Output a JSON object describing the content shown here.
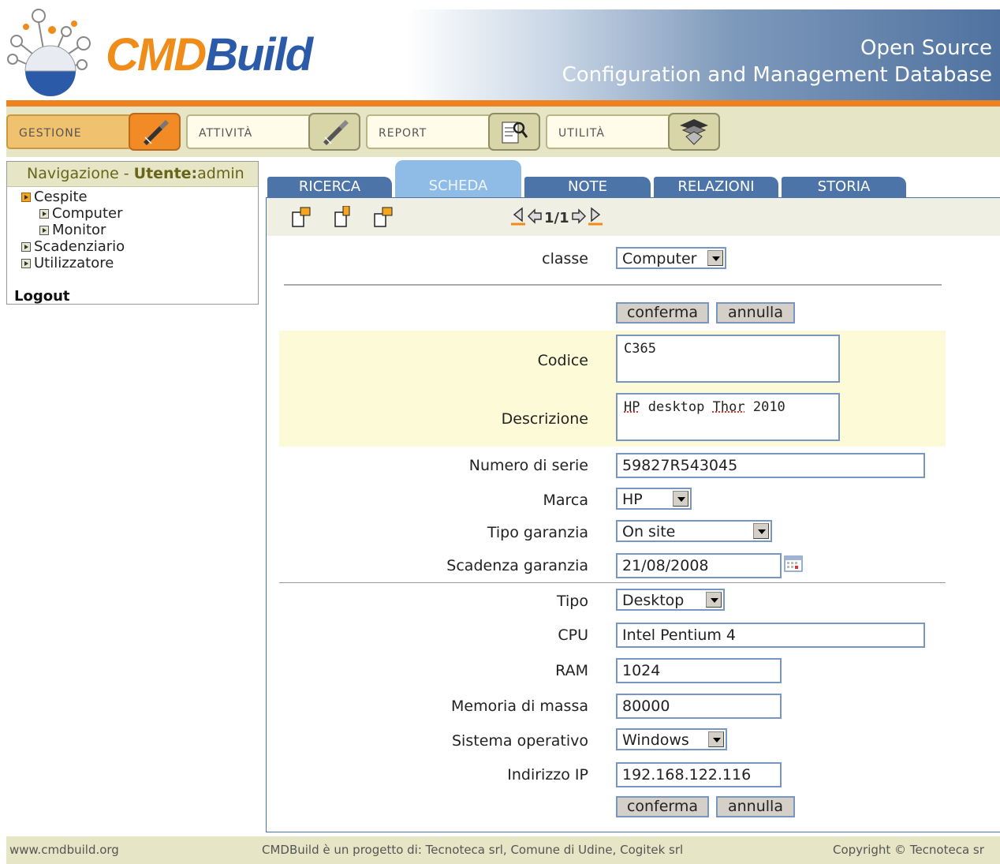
{
  "header": {
    "logo_cmd": "CMD",
    "logo_build": "Build",
    "tagline_1": "Open Source",
    "tagline_2": "Configuration and Management Database"
  },
  "menu": {
    "items": [
      {
        "label": "GESTIONE",
        "icon": "screwdriver-icon",
        "active": true
      },
      {
        "label": "ATTIVITÀ",
        "icon": "screwdriver-icon",
        "active": false
      },
      {
        "label": "REPORT",
        "icon": "report-magnifier-icon",
        "active": false
      },
      {
        "label": "UTILITÀ",
        "icon": "tools-stack-icon",
        "active": false
      }
    ]
  },
  "nav": {
    "title_prefix": "Navigazione - ",
    "user_label": "Utente:",
    "user_name": "admin",
    "tree": [
      {
        "label": "Cespite"
      },
      {
        "label": "Computer"
      },
      {
        "label": "Monitor"
      },
      {
        "label": "Scadenziario"
      },
      {
        "label": "Utilizzatore"
      }
    ],
    "logout": "Logout"
  },
  "tabs": [
    {
      "label": "RICERCA",
      "active": false
    },
    {
      "label": "SCHEDA",
      "active": true
    },
    {
      "label": "NOTE",
      "active": false
    },
    {
      "label": "RELAZIONI",
      "active": false
    },
    {
      "label": "STORIA",
      "active": false
    }
  ],
  "pager": {
    "text": "1/1"
  },
  "form": {
    "classe_label": "classe",
    "classe_value": "Computer",
    "confirm": "conferma",
    "cancel": "annulla",
    "codice_label": "Codice",
    "codice_value": "C365",
    "descrizione_label": "Descrizione",
    "descrizione_words": [
      "HP",
      "desktop",
      "Thor",
      "2010"
    ],
    "serie_label": "Numero di serie",
    "serie_value": "59827R543045",
    "marca_label": "Marca",
    "marca_value": "HP",
    "garanzia_label": "Tipo garanzia",
    "garanzia_value": "On site",
    "scadenza_label": "Scadenza garanzia",
    "scadenza_value": "21/08/2008",
    "tipo_label": "Tipo",
    "tipo_value": "Desktop",
    "cpu_label": "CPU",
    "cpu_value": "Intel Pentium 4",
    "ram_label": "RAM",
    "ram_value": "1024",
    "memoria_label": "Memoria di massa",
    "memoria_value": "80000",
    "so_label": "Sistema operativo",
    "so_value": "Windows",
    "ip_label": "Indirizzo IP",
    "ip_value": "192.168.122.116"
  },
  "footer": {
    "site": "www.cmdbuild.org",
    "credits": "CMDBuild è un progetto di: Tecnoteca srl, Comune di Udine, Cogitek srl",
    "copyright": "Copyright © Tecnoteca sr"
  },
  "colors": {
    "accent_orange": "#ee8120",
    "brand_blue": "#2a5aa8",
    "tab_blue": "#4c74a8",
    "tab_active": "#8fbce6",
    "menu_bg": "#e6e5c6",
    "highlight": "#fdfbd7"
  }
}
